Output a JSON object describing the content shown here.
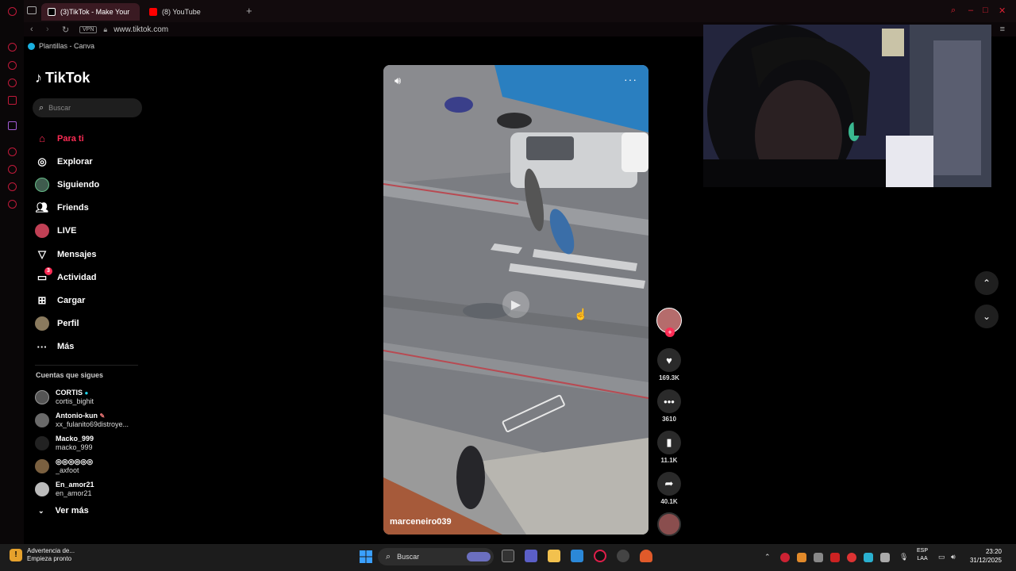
{
  "browser": {
    "tabs": [
      {
        "label": "(3)TikTok - Make Your",
        "icon": "tiktok-icon",
        "active": true
      },
      {
        "label": "(8) YouTube",
        "icon": "youtube-icon",
        "active": false
      }
    ],
    "new_tab": "+",
    "vpn": "VPN",
    "url": "www.tiktok.com",
    "bookmark": "Plantillas - Canva"
  },
  "tiktok": {
    "logo": "TikTok",
    "search_placeholder": "Buscar",
    "nav": [
      {
        "label": "Para ti",
        "icon": "home-icon",
        "active": true
      },
      {
        "label": "Explorar",
        "icon": "compass-icon"
      },
      {
        "label": "Siguiendo",
        "icon": "following-avatar-icon"
      },
      {
        "label": "Friends",
        "icon": "friends-icon"
      },
      {
        "label": "LIVE",
        "icon": "live-icon"
      },
      {
        "label": "Mensajes",
        "icon": "messages-icon"
      },
      {
        "label": "Actividad",
        "icon": "activity-icon",
        "badge": "3"
      },
      {
        "label": "Cargar",
        "icon": "upload-icon"
      },
      {
        "label": "Perfil",
        "icon": "profile-avatar-icon"
      },
      {
        "label": "Más",
        "icon": "more-dots-icon"
      }
    ],
    "following_title": "Cuentas que sigues",
    "following": [
      {
        "name": "CORTIS",
        "handle": "cortis_bighit",
        "verified": true
      },
      {
        "name": "Antonio-kun",
        "handle": "xx_fulanito69distroye..."
      },
      {
        "name": "Macko_999",
        "handle": "macko_999"
      },
      {
        "name": "◎◎◎◎◎◎",
        "handle": "_axfoot"
      },
      {
        "name": "En_amor21",
        "handle": "en_amor21"
      }
    ],
    "see_more": "Ver más",
    "video": {
      "author": "marceneiro039",
      "likes": "169.3K",
      "comments": "3610",
      "saves": "11.1K",
      "shares": "40.1K"
    }
  },
  "taskbar": {
    "notification_title": "Advertencia de...",
    "notification_sub": "Empieza pronto",
    "search": "Buscar",
    "lang1": "ESP",
    "lang2": "LAA",
    "time": "23:20",
    "date": "31/12/2025"
  },
  "colors": {
    "accent": "#fe2c55",
    "opera_red": "#c01a3a"
  }
}
